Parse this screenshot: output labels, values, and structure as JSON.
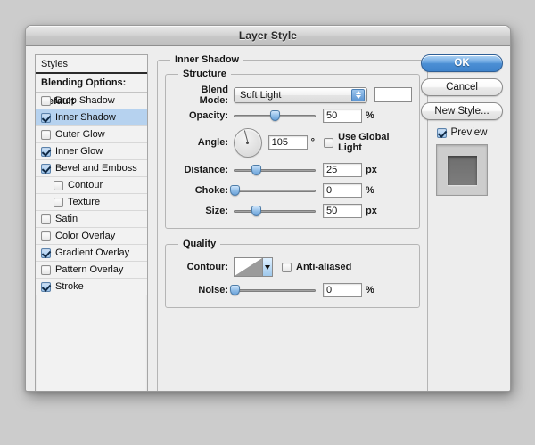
{
  "window": {
    "title": "Layer Style"
  },
  "sidebar": {
    "header": "Styles",
    "blending_options": "Blending Options: Default",
    "items": [
      {
        "label": "Drop Shadow",
        "checked": false,
        "selected": false,
        "sub": false
      },
      {
        "label": "Inner Shadow",
        "checked": true,
        "selected": true,
        "sub": false
      },
      {
        "label": "Outer Glow",
        "checked": false,
        "selected": false,
        "sub": false
      },
      {
        "label": "Inner Glow",
        "checked": true,
        "selected": false,
        "sub": false
      },
      {
        "label": "Bevel and Emboss",
        "checked": true,
        "selected": false,
        "sub": false
      },
      {
        "label": "Contour",
        "checked": false,
        "selected": false,
        "sub": true
      },
      {
        "label": "Texture",
        "checked": false,
        "selected": false,
        "sub": true
      },
      {
        "label": "Satin",
        "checked": false,
        "selected": false,
        "sub": false
      },
      {
        "label": "Color Overlay",
        "checked": false,
        "selected": false,
        "sub": false
      },
      {
        "label": "Gradient Overlay",
        "checked": true,
        "selected": false,
        "sub": false
      },
      {
        "label": "Pattern Overlay",
        "checked": false,
        "selected": false,
        "sub": false
      },
      {
        "label": "Stroke",
        "checked": true,
        "selected": false,
        "sub": false
      }
    ]
  },
  "main": {
    "group_title": "Inner Shadow",
    "structure": {
      "title": "Structure",
      "blend_mode": {
        "label": "Blend Mode:",
        "value": "Soft Light",
        "swatch_color": "#ffffff"
      },
      "opacity": {
        "label": "Opacity:",
        "value": "50",
        "unit": "%",
        "percent": 50
      },
      "angle": {
        "label": "Angle:",
        "value": "105",
        "unit": "°",
        "degrees": 105
      },
      "use_global_light": {
        "label": "Use Global Light",
        "checked": false
      },
      "distance": {
        "label": "Distance:",
        "value": "25",
        "unit": "px",
        "percent": 27
      },
      "choke": {
        "label": "Choke:",
        "value": "0",
        "unit": "%",
        "percent": 0
      },
      "size": {
        "label": "Size:",
        "value": "50",
        "unit": "px",
        "percent": 27
      }
    },
    "quality": {
      "title": "Quality",
      "contour": {
        "label": "Contour:"
      },
      "anti_aliased": {
        "label": "Anti-aliased",
        "checked": false
      },
      "noise": {
        "label": "Noise:",
        "value": "0",
        "unit": "%",
        "percent": 0
      }
    }
  },
  "actions": {
    "ok": "OK",
    "cancel": "Cancel",
    "new_style": "New Style...",
    "preview": {
      "label": "Preview",
      "checked": true
    }
  },
  "colors": {
    "accent_blue": "#4c8fd4",
    "selection_blue": "#b6d2ef",
    "window_bg": "#ededed",
    "desktop_bg": "#cccccc"
  }
}
